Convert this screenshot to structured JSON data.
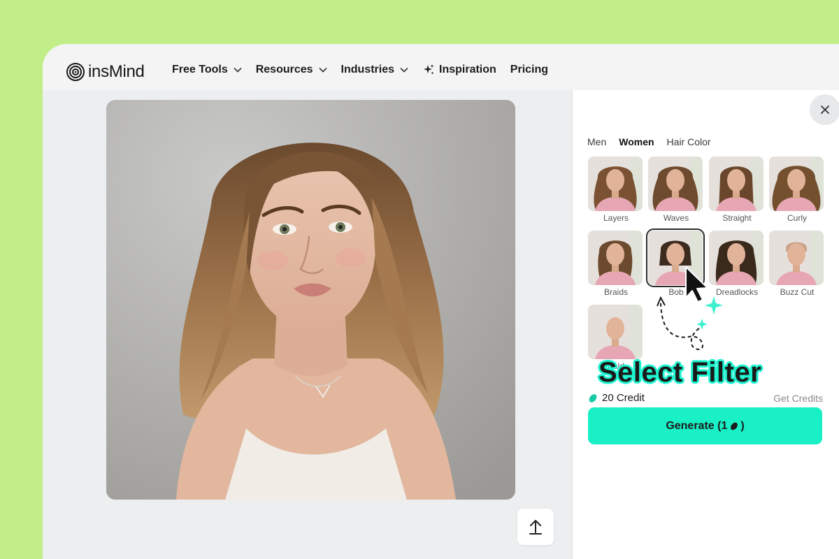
{
  "brand": {
    "name": "insMind"
  },
  "nav": {
    "items": [
      {
        "label": "Free Tools",
        "has_dropdown": true
      },
      {
        "label": "Resources",
        "has_dropdown": true
      },
      {
        "label": "Industries",
        "has_dropdown": true
      },
      {
        "label": "Inspiration",
        "icon": "sparkle-icon"
      },
      {
        "label": "Pricing"
      }
    ]
  },
  "panel": {
    "tabs": [
      {
        "label": "Men",
        "active": false
      },
      {
        "label": "Women",
        "active": true
      },
      {
        "label": "Hair Color",
        "active": false
      }
    ],
    "styles": [
      {
        "label": "Layers",
        "selected": false
      },
      {
        "label": "Waves",
        "selected": false
      },
      {
        "label": "Straight",
        "selected": false
      },
      {
        "label": "Curly",
        "selected": false
      },
      {
        "label": "Braids",
        "selected": false
      },
      {
        "label": "Bob",
        "selected": true
      },
      {
        "label": "Dreadlocks",
        "selected": false
      },
      {
        "label": "Buzz Cut",
        "selected": false
      },
      {
        "label": "Bald",
        "selected": false
      }
    ],
    "credits": "20 Credit",
    "get_credits": "Get Credits",
    "generate_label": "Generate (1",
    "generate_suffix": ")"
  },
  "annotation": {
    "text": "Select Filter"
  },
  "colors": {
    "background": "#c1ee88",
    "accent": "#19f0c6",
    "highlight": "#1ff4d1"
  }
}
